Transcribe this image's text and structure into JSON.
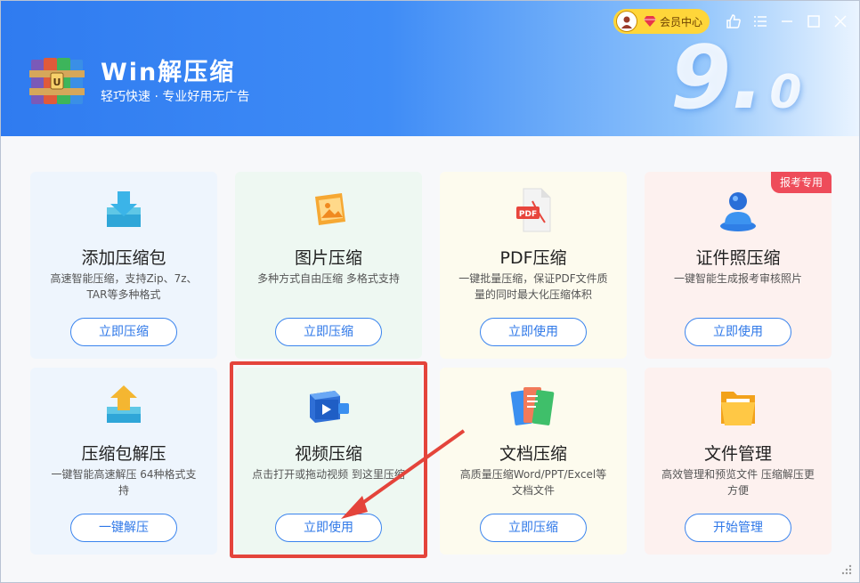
{
  "app": {
    "title": "Win解压缩",
    "subtitle": "轻巧快速 · 专业好用无广告",
    "version_major": "9.",
    "version_minor": "0"
  },
  "topbar": {
    "vip_label": "会员中心"
  },
  "colors": {
    "header_start": "#2f7bf0",
    "accent": "#3a84ee",
    "badge": "#ee4c5a",
    "highlight": "#e4443b"
  },
  "cards": [
    {
      "title": "添加压缩包",
      "desc": "高速智能压缩，支持Zip、7z、TAR等多种格式",
      "button": "立即压缩",
      "icon": "add-archive-icon"
    },
    {
      "title": "图片压缩",
      "desc": "多种方式自由压缩 多格式支持",
      "button": "立即压缩",
      "icon": "image-compress-icon"
    },
    {
      "title": "PDF压缩",
      "desc": "一键批量压缩，保证PDF文件质量的同时最大化压缩体积",
      "button": "立即使用",
      "icon": "pdf-icon"
    },
    {
      "title": "证件照压缩",
      "desc": "一键智能生成报考审核照片",
      "button": "立即使用",
      "icon": "id-photo-icon",
      "badge": "报考专用"
    },
    {
      "title": "压缩包解压",
      "desc": "一键智能高速解压 64种格式支持",
      "button": "一键解压",
      "icon": "extract-archive-icon"
    },
    {
      "title": "视频压缩",
      "desc": "点击打开或拖动视频 到这里压缩",
      "button": "立即使用",
      "icon": "video-icon"
    },
    {
      "title": "文档压缩",
      "desc": "高质量压缩Word/PPT/Excel等文档文件",
      "button": "立即压缩",
      "icon": "document-icon"
    },
    {
      "title": "文件管理",
      "desc": "高效管理和预览文件 压缩解压更方便",
      "button": "开始管理",
      "icon": "folder-icon"
    }
  ]
}
